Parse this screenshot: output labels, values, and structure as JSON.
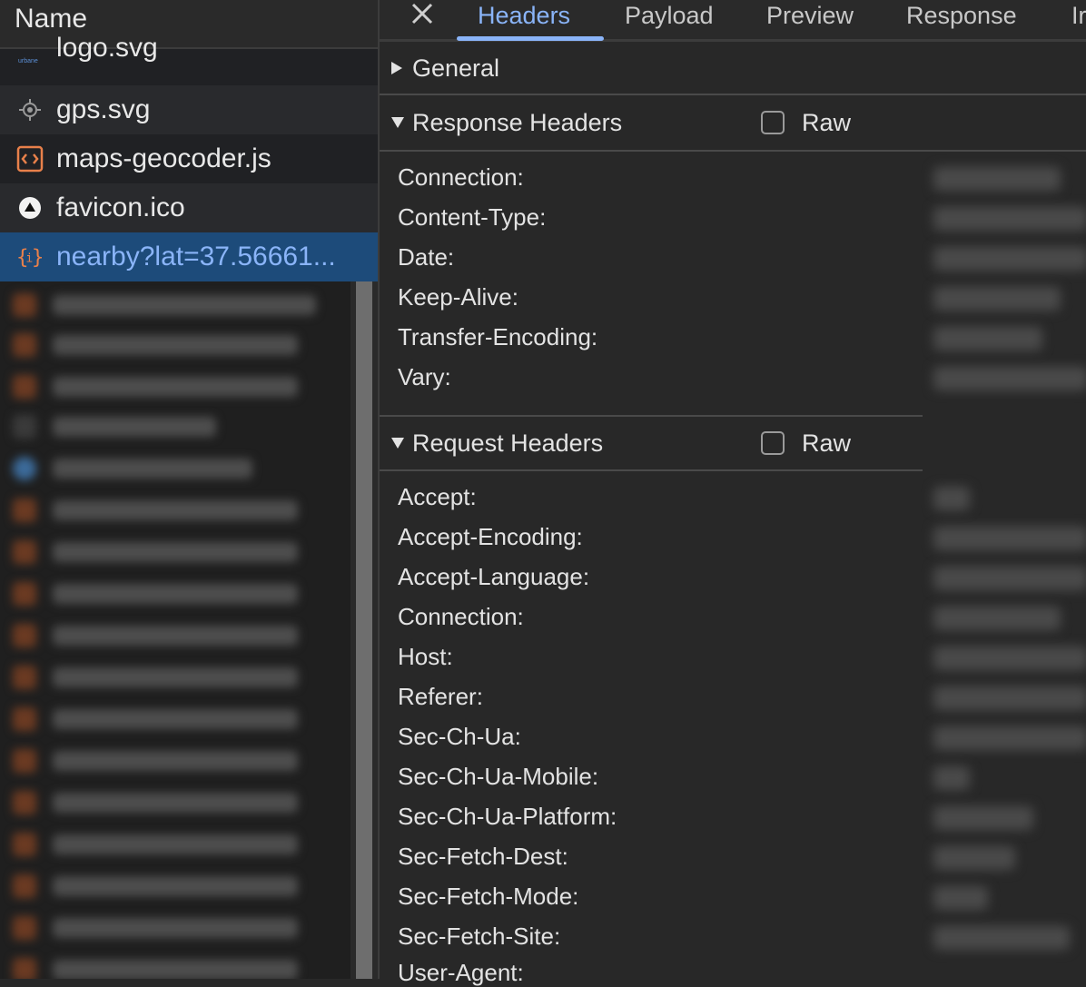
{
  "list": {
    "header": "Name",
    "items": [
      {
        "name": "logo.svg",
        "icon": "logo-image-icon"
      },
      {
        "name": "gps.svg",
        "icon": "gps-icon"
      },
      {
        "name": "maps-geocoder.js",
        "icon": "script-icon"
      },
      {
        "name": "favicon.ico",
        "icon": "favicon-icon"
      },
      {
        "name": "nearby?lat=37.56661...",
        "icon": "fetch-json-icon"
      }
    ]
  },
  "tabs": [
    "Headers",
    "Payload",
    "Preview",
    "Response",
    "Ir"
  ],
  "active_tab": "Headers",
  "sections": {
    "general": {
      "title": "General"
    },
    "response": {
      "title": "Response Headers",
      "raw_label": "Raw",
      "headers": [
        "Connection:",
        "Content-Type:",
        "Date:",
        "Keep-Alive:",
        "Transfer-Encoding:",
        "Vary:"
      ]
    },
    "request": {
      "title": "Request Headers",
      "raw_label": "Raw",
      "headers": [
        "Accept:",
        "Accept-Encoding:",
        "Accept-Language:",
        "Connection:",
        "Host:",
        "Referer:",
        "Sec-Ch-Ua:",
        "Sec-Ch-Ua-Mobile:",
        "Sec-Ch-Ua-Platform:",
        "Sec-Fetch-Dest:",
        "Sec-Fetch-Mode:",
        "Sec-Fetch-Site:",
        "User-Agent:"
      ]
    }
  },
  "colors": {
    "accent": "#8ab4f8",
    "selected_row": "#1d4b7a",
    "script_icon": "#e8804a"
  }
}
